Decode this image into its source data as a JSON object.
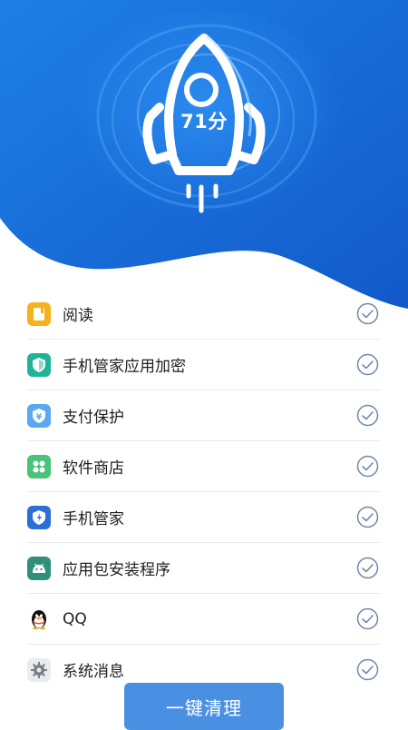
{
  "hero": {
    "score": "71分"
  },
  "apps": [
    {
      "name": "阅读",
      "icon": "book-icon",
      "checked": true
    },
    {
      "name": "手机管家应用加密",
      "icon": "shield-icon",
      "checked": true
    },
    {
      "name": "支付保护",
      "icon": "yuan-shield-icon",
      "checked": true
    },
    {
      "name": "软件商店",
      "icon": "store-icon",
      "checked": true
    },
    {
      "name": "手机管家",
      "icon": "phone-manager-icon",
      "checked": true
    },
    {
      "name": "应用包安装程序",
      "icon": "android-installer-icon",
      "checked": true
    },
    {
      "name": "QQ",
      "icon": "penguin-icon",
      "checked": true
    },
    {
      "name": "系统消息",
      "icon": "gear-icon",
      "checked": true
    }
  ],
  "actions": {
    "clean_label": "一键清理"
  },
  "colors": {
    "accent": "#1a73e8",
    "button": "#4a90e2",
    "check": "#5a7ba3"
  }
}
